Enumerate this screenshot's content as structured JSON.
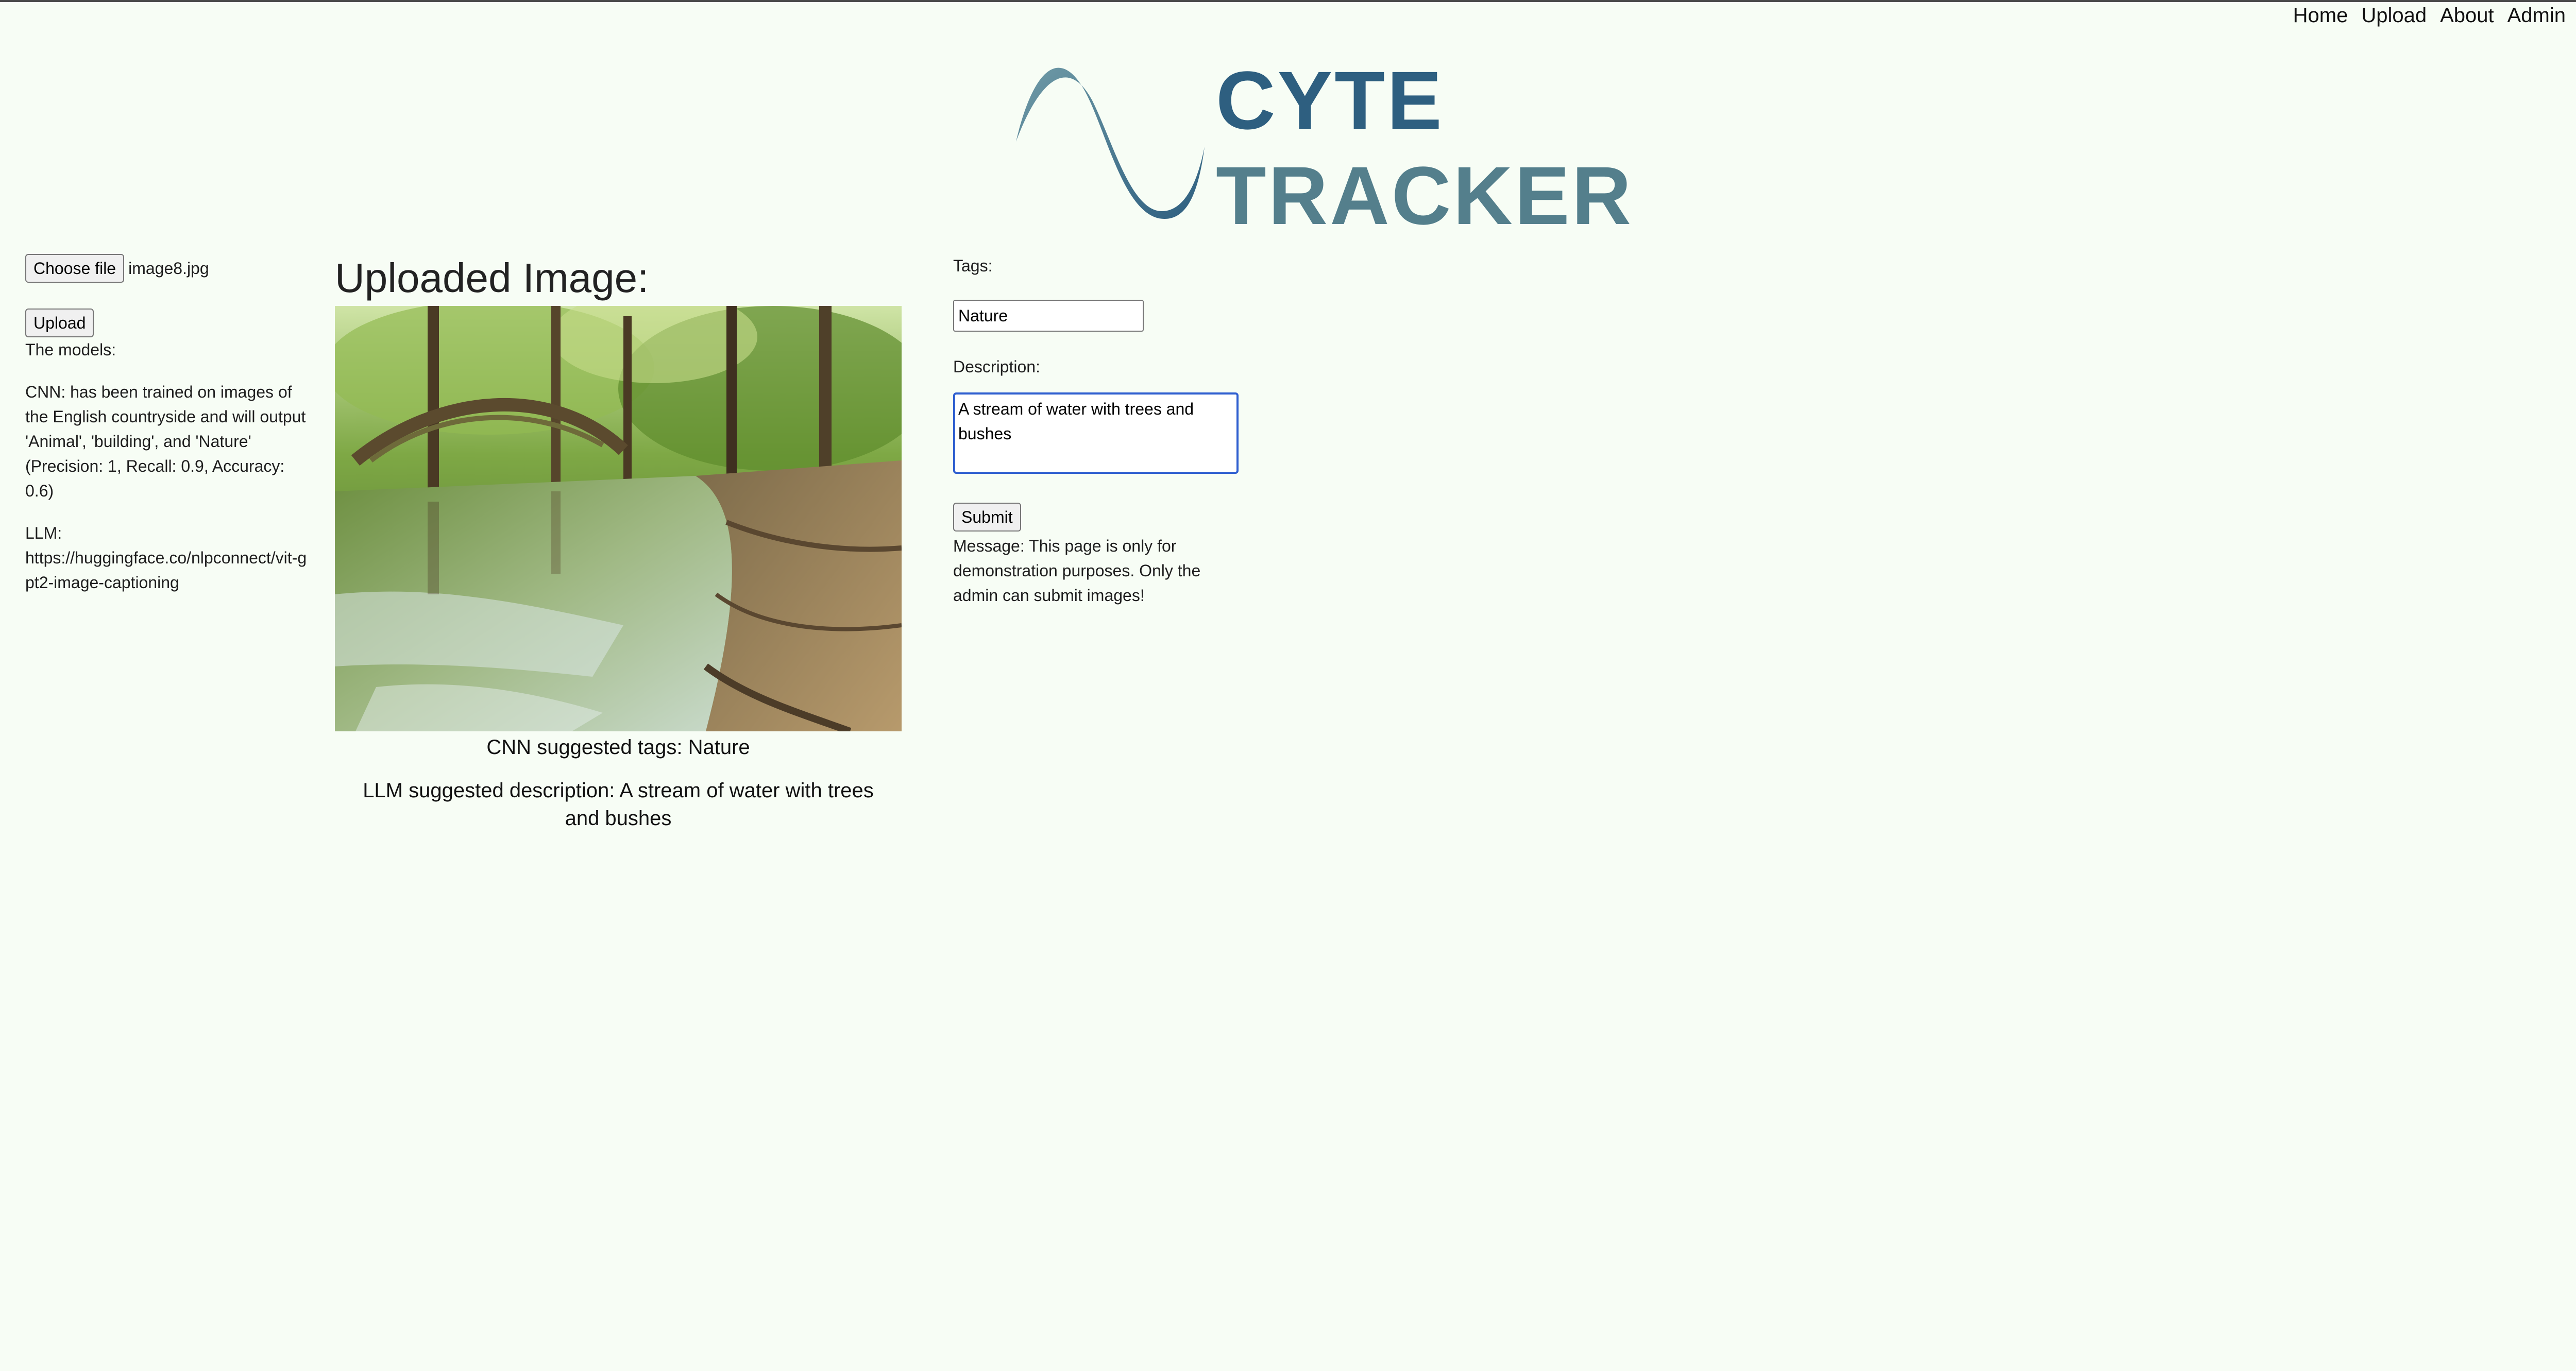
{
  "nav": {
    "items": [
      "Home",
      "Upload",
      "About",
      "Admin"
    ]
  },
  "logo": {
    "line1": "CYTE",
    "line2": "TRACKER",
    "colors": {
      "dark": "#2e5f80",
      "light": "#547f8c"
    }
  },
  "left": {
    "choose_file_label": "Choose file",
    "file_name": "image8.jpg",
    "upload_label": "Upload",
    "models_title": "The models:",
    "cnn_text": "CNN: has been trained on images of the English countryside and will output 'Animal', 'building', and 'Nature' (Precision: 1, Recall: 0.9, Accuracy: 0.6)",
    "llm_label": "LLM:",
    "llm_url": "https://huggingface.co/nlpconnect/vit-gpt2-image-captioning"
  },
  "center": {
    "heading": "Uploaded Image:",
    "cnn_tags": "CNN suggested tags: Nature",
    "llm_description": "LLM suggested description: A stream of water with trees and bushes"
  },
  "right": {
    "tags_label": "Tags:",
    "tags_value": "Nature",
    "description_label": "Description:",
    "description_value": "A stream of water with trees and bushes",
    "submit_label": "Submit",
    "message": "Message: This page is only for demonstration purposes. Only the admin can submit images!"
  },
  "colors": {
    "background": "#f7fdf5",
    "focus_border": "#2f5fd0"
  }
}
